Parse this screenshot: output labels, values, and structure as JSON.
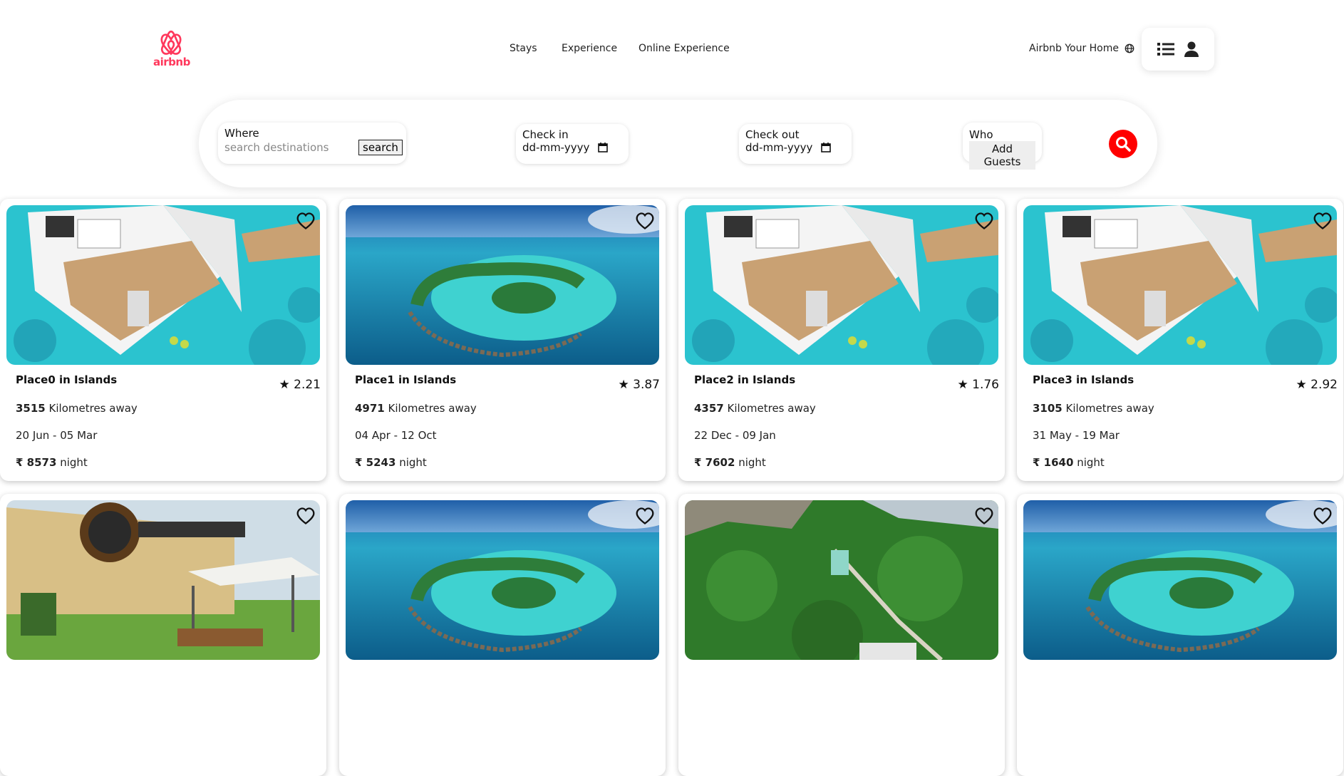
{
  "header": {
    "logo_text": "airbnb",
    "nav": [
      "Stays",
      "Experience",
      "Online Experience"
    ],
    "host_label": "Airbnb Your Home"
  },
  "search": {
    "where_label": "Where",
    "where_placeholder": "search destinations",
    "where_button": "search",
    "checkin_label": "Check in",
    "checkin_value": "dd-mm-yyyy",
    "checkout_label": "Check out",
    "checkout_value": "dd-mm-yyyy",
    "who_label": "Who",
    "who_button": "Add Guests"
  },
  "colors": {
    "brand": "#ff385c",
    "search_button": "#ff0000"
  },
  "listings": [
    {
      "title": "Place0 in Islands",
      "rating": "★ 2.21",
      "distance": "3515",
      "distance_suffix": "Kilometres away",
      "dates": "20 Jun - 05 Mar",
      "price": "₹ 8573",
      "price_suffix": "night",
      "image": "overwater-villa-render"
    },
    {
      "title": "Place1 in Islands",
      "rating": "★ 3.87",
      "distance": "4971",
      "distance_suffix": "Kilometres away",
      "dates": "04 Apr - 12 Oct",
      "price": "₹ 5243",
      "price_suffix": "night",
      "image": "atoll-aerial"
    },
    {
      "title": "Place2 in Islands",
      "rating": "★ 1.76",
      "distance": "4357",
      "distance_suffix": "Kilometres away",
      "dates": "22 Dec - 09 Jan",
      "price": "₹ 7602",
      "price_suffix": "night",
      "image": "overwater-villa-render"
    },
    {
      "title": "Place3 in Islands",
      "rating": "★ 2.92",
      "distance": "3105",
      "distance_suffix": "Kilometres away",
      "dates": "31 May - 19 Mar",
      "price": "₹ 1640",
      "price_suffix": "night",
      "image": "overwater-villa-render"
    }
  ],
  "listings_row2_images": [
    "guitar-building",
    "atoll-aerial",
    "jungle-aerial",
    "atoll-aerial"
  ]
}
